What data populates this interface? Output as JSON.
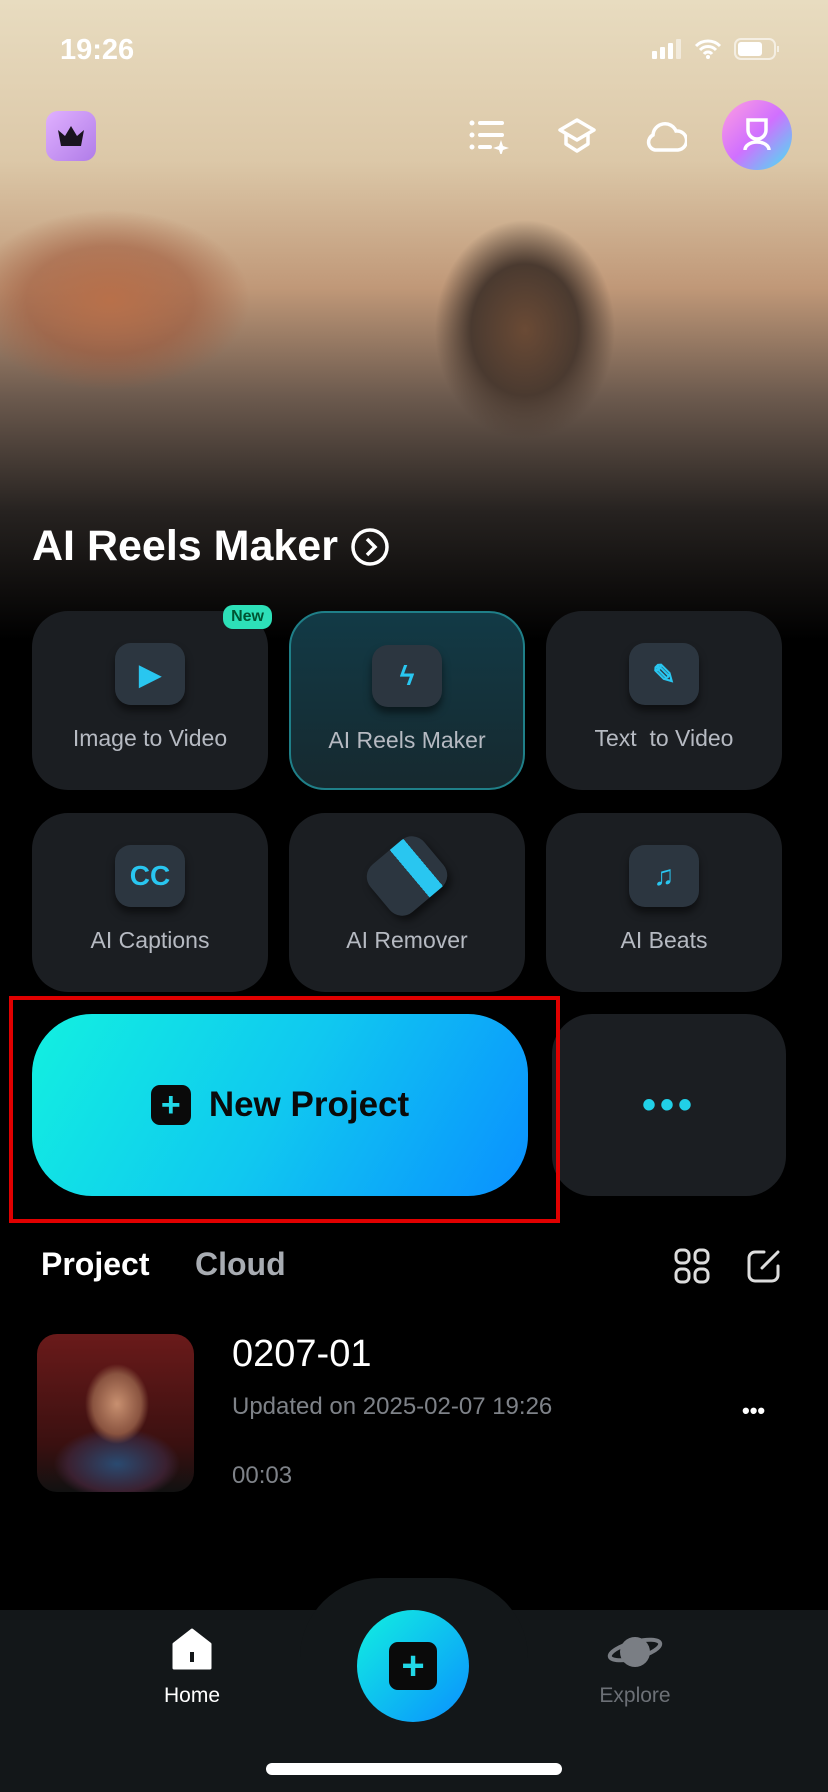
{
  "status_bar": {
    "time": "19:26"
  },
  "header": {
    "icons": [
      "crown-icon",
      "task-list-icon",
      "graduation-cap-icon",
      "cloud-icon",
      "avatar"
    ]
  },
  "hero": {
    "title": "AI Reels Maker"
  },
  "tools": [
    {
      "label": "Image to Video",
      "icon": "image-to-video-icon",
      "badge": "New"
    },
    {
      "label": "AI Reels Maker",
      "icon": "lightning-icon",
      "active": true
    },
    {
      "label": "Text  to Video",
      "icon": "pencil-icon"
    },
    {
      "label": "AI Captions",
      "icon": "cc-icon",
      "glyph": "CC"
    },
    {
      "label": "AI Remover",
      "icon": "eraser-icon"
    },
    {
      "label": "AI Beats",
      "icon": "music-beats-icon"
    }
  ],
  "new_project": {
    "label": "New Project",
    "more": "•••"
  },
  "tabs": [
    {
      "label": "Project",
      "active": true
    },
    {
      "label": "Cloud"
    }
  ],
  "projects": [
    {
      "name": "0207-01",
      "updated": "Updated on 2025-02-07 19:26",
      "duration": "00:03",
      "more": "•••"
    }
  ],
  "bottom_nav": {
    "home": "Home",
    "explore": "Explore",
    "add": "+"
  },
  "colors": {
    "accent": "#12f0e0",
    "accent2": "#0a90ff",
    "highlight": "#e00000"
  }
}
